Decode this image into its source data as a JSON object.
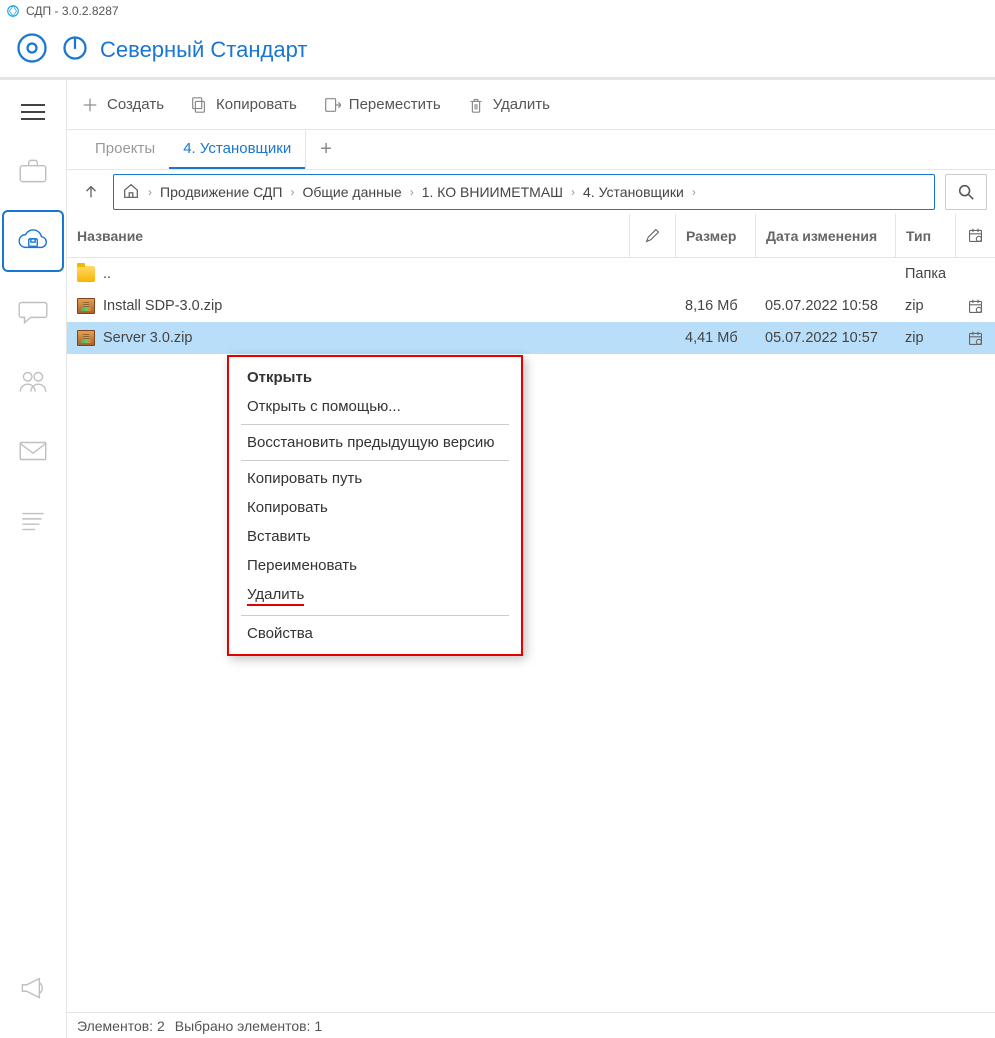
{
  "window": {
    "title": "СДП - 3.0.2.8287"
  },
  "header": {
    "org_name": "Северный Стандарт"
  },
  "toolbar": {
    "create": "Создать",
    "copy": "Копировать",
    "move": "Переместить",
    "delete": "Удалить"
  },
  "tabs": {
    "items": [
      "Проекты",
      "4. Установщики"
    ],
    "active_index": 1
  },
  "breadcrumb": {
    "segments": [
      "Продвижение СДП",
      "Общие данные",
      "1. КО ВНИИМЕТМАШ",
      "4. Установщики"
    ]
  },
  "columns": {
    "name": "Название",
    "size": "Размер",
    "date": "Дата изменения",
    "type": "Тип"
  },
  "rows": [
    {
      "icon": "folder",
      "name": "..",
      "size": "",
      "date": "",
      "type": "Папка",
      "cal": false,
      "selected": false
    },
    {
      "icon": "zip",
      "name": "Install SDP-3.0.zip",
      "size": "8,16 Мб",
      "date": "05.07.2022 10:58",
      "type": "zip",
      "cal": true,
      "selected": false
    },
    {
      "icon": "zip",
      "name": "Server 3.0.zip",
      "size": "4,41 Мб",
      "date": "05.07.2022 10:57",
      "type": "zip",
      "cal": true,
      "selected": true
    }
  ],
  "context_menu": {
    "open": "Открыть",
    "open_with": "Открыть с помощью...",
    "restore_prev": "Восстановить предыдущую версию",
    "copy_path": "Копировать путь",
    "copy": "Копировать",
    "paste": "Вставить",
    "rename": "Переименовать",
    "delete": "Удалить",
    "properties": "Свойства"
  },
  "status": {
    "elements": "Элементов: 2",
    "selected": "Выбрано элементов: 1"
  }
}
